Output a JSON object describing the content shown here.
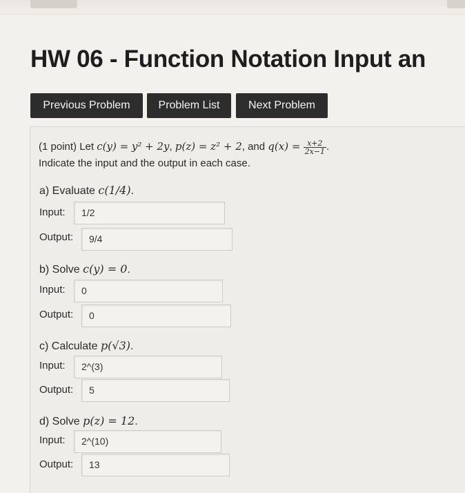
{
  "page": {
    "title": "HW 06 - Function Notation Input an"
  },
  "nav": {
    "previous": "Previous Problem",
    "list": "Problem List",
    "next": "Next Problem"
  },
  "problem": {
    "points": "(1 point) Let",
    "c_def": "c(y) = y² + 2y",
    "p_def": "p(z) = z² + 2",
    "and": ", and",
    "q_lhs": "q(x) =",
    "q_num": "x+2",
    "q_den": "2x−1",
    "instruction": "Indicate the input and the output in each case.",
    "parts": [
      {
        "prompt": "a) Evaluate",
        "expr": "c(1/4)",
        "input_label": "Input:",
        "input_value": "1/2",
        "output_label": "Output:",
        "output_value": "9/4"
      },
      {
        "prompt": "b) Solve",
        "expr": "c(y) = 0",
        "input_label": "Input:",
        "input_value": "0",
        "output_label": "Output:",
        "output_value": "0"
      },
      {
        "prompt": "c) Calculate",
        "expr": "p(√3)",
        "input_label": "Input:",
        "input_value": "2^(3)",
        "output_label": "Output:",
        "output_value": "5"
      },
      {
        "prompt": "d) Solve",
        "expr": "p(z) = 12",
        "input_label": "Input:",
        "input_value": "2^(10)",
        "output_label": "Output:",
        "output_value": "13"
      }
    ]
  }
}
